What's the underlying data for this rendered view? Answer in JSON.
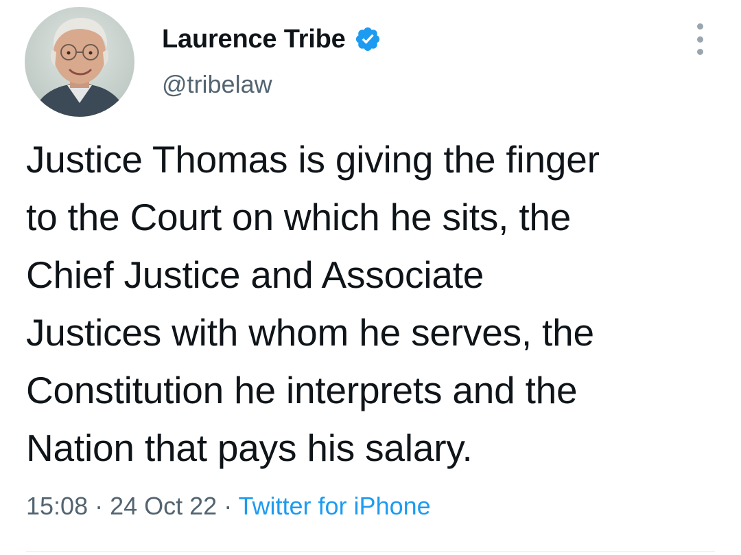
{
  "author": {
    "display_name": "Laurence Tribe",
    "handle": "@tribelaw",
    "verified": true
  },
  "tweet": {
    "lines": [
      "Justice Thomas is giving the finger",
      "to the Court on which he sits, the",
      "Chief Justice and Associate",
      "Justices with whom he serves, the",
      "Constitution he interprets and the",
      "Nation that pays his salary."
    ]
  },
  "meta": {
    "time": "15:08",
    "separator": " · ",
    "date": "24 Oct 22",
    "source": "Twitter for iPhone"
  },
  "icons": {
    "verified": "verified-badge-icon",
    "more": "more-options-icon"
  },
  "colors": {
    "text": "#0f1419",
    "secondary": "#536471",
    "accent": "#1d9bf0"
  }
}
